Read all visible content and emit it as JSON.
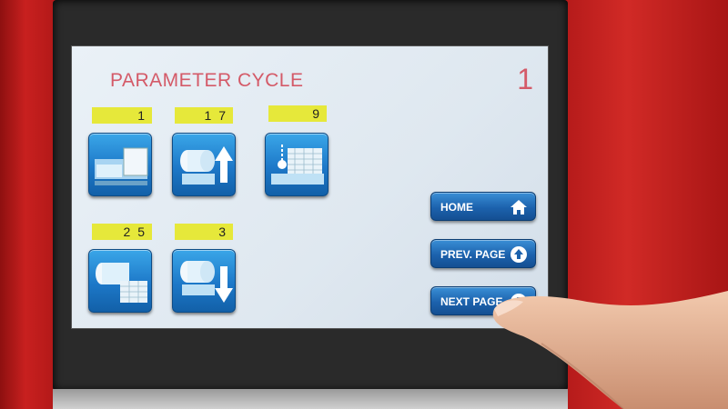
{
  "screen": {
    "title": "PARAMETER CYCLE",
    "page_number": "1"
  },
  "parameters": [
    {
      "value": "1",
      "icon": "frame-plate-icon"
    },
    {
      "value": "1 7",
      "icon": "roll-up-arrow-icon"
    },
    {
      "value": "9",
      "icon": "sensor-mesh-icon"
    },
    {
      "value": "2 5",
      "icon": "roll-mesh-icon"
    },
    {
      "value": "3",
      "icon": "roll-down-arrow-icon"
    }
  ],
  "nav": {
    "home_label": "HOME",
    "prev_label": "PREV. PAGE",
    "next_label": "NEXT PAGE"
  },
  "colors": {
    "title": "#d45a68",
    "value_field": "#e6e83a",
    "tile_blue": "#1d78c8",
    "housing_red": "#c21f1f"
  }
}
